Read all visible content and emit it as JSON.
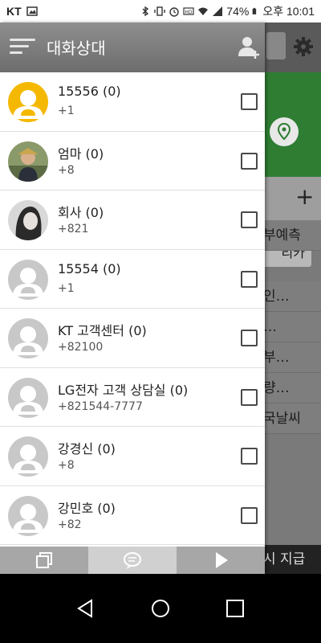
{
  "statusbar": {
    "carrier": "KT",
    "battery": "74%",
    "time": "오후 10:01"
  },
  "background_app": {
    "rows": [
      "부예측",
      "인…",
      "…",
      "부…",
      "량…",
      "국날씨"
    ],
    "button": "리카",
    "bottom_text": "시 지급"
  },
  "drawer": {
    "title": "대화상대",
    "contacts": [
      {
        "name": "15556 (0)",
        "phone": "+1",
        "avatar": "yellow-default"
      },
      {
        "name": "엄마 (0)",
        "phone": "+8",
        "avatar": "photo"
      },
      {
        "name": "회사 (0)",
        "phone": "+821",
        "avatar": "photo"
      },
      {
        "name": "15554 (0)",
        "phone": "+1",
        "avatar": "gray-default"
      },
      {
        "name": "KT 고객센터 (0)",
        "phone": "+82100",
        "avatar": "gray-default"
      },
      {
        "name": "LG전자 고객 상담실 (0)",
        "phone": "+821544-7777",
        "avatar": "gray-default"
      },
      {
        "name": "강경신 (0)",
        "phone": "+8",
        "avatar": "gray-default"
      },
      {
        "name": "강민호 (0)",
        "phone": "+82",
        "avatar": "gray-default"
      }
    ],
    "footer_tabs": [
      {
        "icon": "copy-icon",
        "active": false
      },
      {
        "icon": "chat-icon",
        "active": true
      },
      {
        "icon": "play-icon",
        "active": false
      }
    ]
  },
  "colors": {
    "avatar_yellow": "#f5b800",
    "avatar_gray": "#c8c8c8",
    "bg_green": "#2e7d32"
  }
}
